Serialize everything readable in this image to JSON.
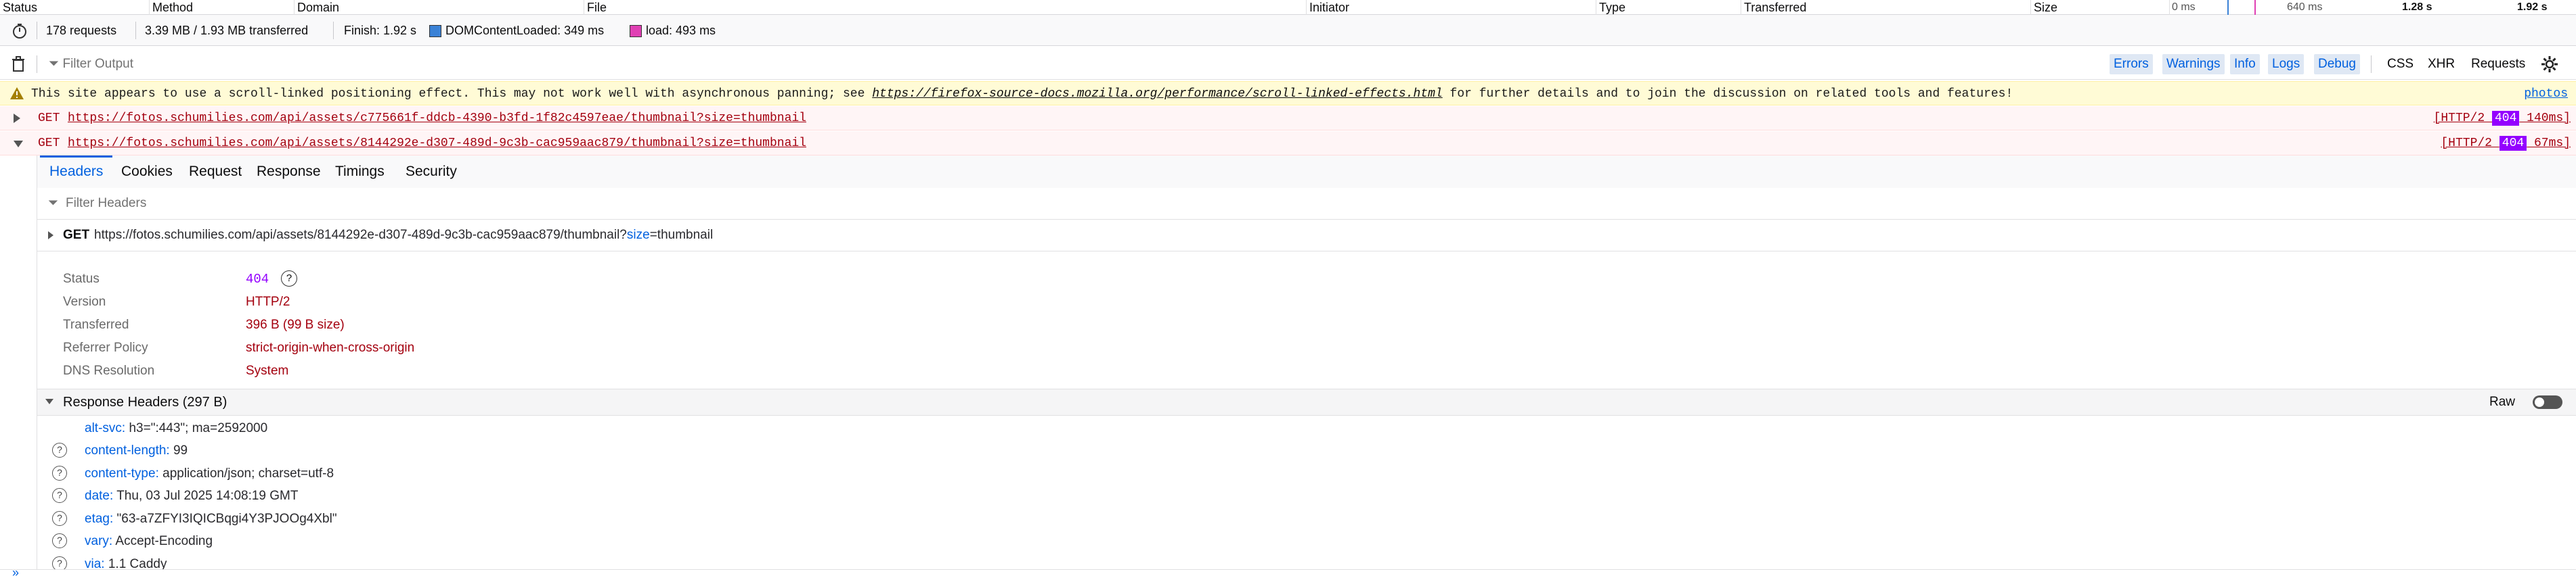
{
  "net_header": {
    "columns": [
      "Status",
      "Method",
      "Domain",
      "File",
      "Initiator",
      "Type",
      "Transferred",
      "Size"
    ],
    "waterfall": {
      "t0": "0 ms",
      "t1": "640 ms",
      "t2": "1.28 s",
      "t3": "1.92 s"
    }
  },
  "summary": {
    "requests": "178 requests",
    "transferred": "3.39 MB / 1.93 MB transferred",
    "finish": "Finish: 1.92 s",
    "domcontentloaded": "DOMContentLoaded: 349 ms",
    "load": "load: 493 ms",
    "dcl_color": "#3b82d6",
    "load_color": "#e040b4"
  },
  "toolbar": {
    "trash_icon": "trash-icon",
    "filter_placeholder": "Filter Output",
    "levels": [
      "Errors",
      "Warnings",
      "Info",
      "Logs",
      "Debug"
    ],
    "types": [
      "CSS",
      "XHR",
      "Requests"
    ],
    "gear_icon": "gear-icon"
  },
  "warning": {
    "text_before": "This site appears to use a scroll-linked positioning effect. This may not work well with asynchronous panning; see ",
    "link": "https://firefox-source-docs.mozilla.org/performance/scroll-linked-effects.html",
    "text_after": " for further details and to join the discussion on related tools and features!",
    "source": "photos"
  },
  "requests": [
    {
      "method": "GET",
      "url": "https://fotos.schumilies.com/api/assets/c775661f-ddcb-4390-b3fd-1f82c4597eae/thumbnail?size=thumbnail",
      "proto": "[HTTP/2 ",
      "code": "404",
      "time": " 140ms]"
    },
    {
      "method": "GET",
      "url": "https://fotos.schumilies.com/api/assets/8144292e-d307-489d-9c3b-cac959aac879/thumbnail?size=thumbnail",
      "proto": "[HTTP/2 ",
      "code": "404",
      "time": " 67ms]"
    }
  ],
  "detail": {
    "tabs": [
      "Headers",
      "Cookies",
      "Request",
      "Response",
      "Timings",
      "Security"
    ],
    "filter_placeholder": "Filter Headers",
    "get_method": "GET",
    "get_url_base": "https://fotos.schumilies.com/api/assets/8144292e-d307-489d-9c3b-cac959aac879/thumbnail?",
    "get_param_name": "size",
    "get_param_eq": "=",
    "get_param_value": "thumbnail",
    "props": [
      {
        "label": "Status",
        "value": "404"
      },
      {
        "label": "Version",
        "value": "HTTP/2"
      },
      {
        "label": "Transferred",
        "value": "396 B (99 B size)"
      },
      {
        "label": "Referrer Policy",
        "value": "strict-origin-when-cross-origin"
      },
      {
        "label": "DNS Resolution",
        "value": "System"
      }
    ],
    "response_headers_title": "Response Headers (297 B)",
    "raw_label": "Raw",
    "headers": [
      {
        "name": "alt-svc:",
        "value": "h3=\":443\"; ma=2592000"
      },
      {
        "name": "content-length:",
        "value": "99"
      },
      {
        "name": "content-type:",
        "value": "application/json; charset=utf-8"
      },
      {
        "name": "date:",
        "value": "Thu, 03 Jul 2025 14:08:19 GMT"
      },
      {
        "name": "etag:",
        "value": "\"63-a7ZFYI3IQICBqgi4Y3PJOOg4Xbl\""
      },
      {
        "name": "vary:",
        "value": "Accept-Encoding"
      },
      {
        "name": "via:",
        "value": "1.1 Caddy"
      }
    ],
    "bottom_chevron": "»"
  }
}
